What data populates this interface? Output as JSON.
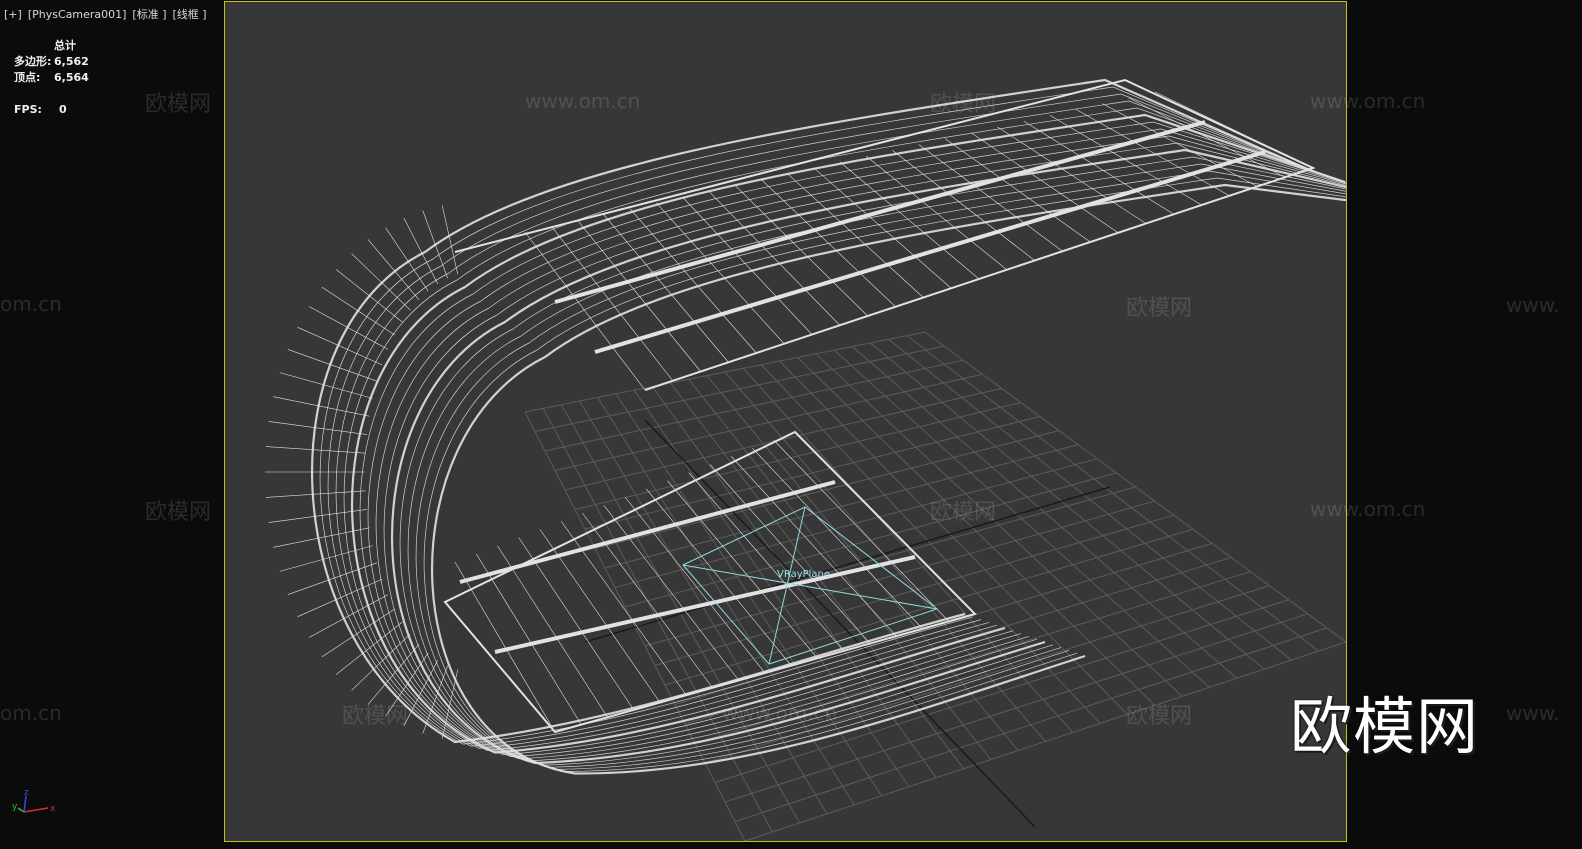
{
  "viewport": {
    "labels": [
      "[+]",
      "[PhysCamera001]",
      "[标准 ]",
      "[线框 ]"
    ]
  },
  "stats": {
    "header": "总计",
    "polygons_label": "多边形:",
    "polygons_value": "6,562",
    "vertices_label": "顶点:",
    "vertices_value": "6,564",
    "fps_label": "FPS:",
    "fps_value": "0"
  },
  "scene": {
    "object_label": "VRayPlane"
  },
  "watermarks": {
    "brand": "欧模网",
    "url": "www.om.cn",
    "url_partial": "om.cn",
    "url_prefix": "www."
  },
  "brand_logo": "欧模网",
  "axis": {
    "x": "x",
    "y": "y",
    "z": "z"
  },
  "colors": {
    "viewport_border": "#c8c01c",
    "viewport_bg": "#373737",
    "wireframe": "#e6e6e6",
    "selection": "#8fd8e0"
  }
}
